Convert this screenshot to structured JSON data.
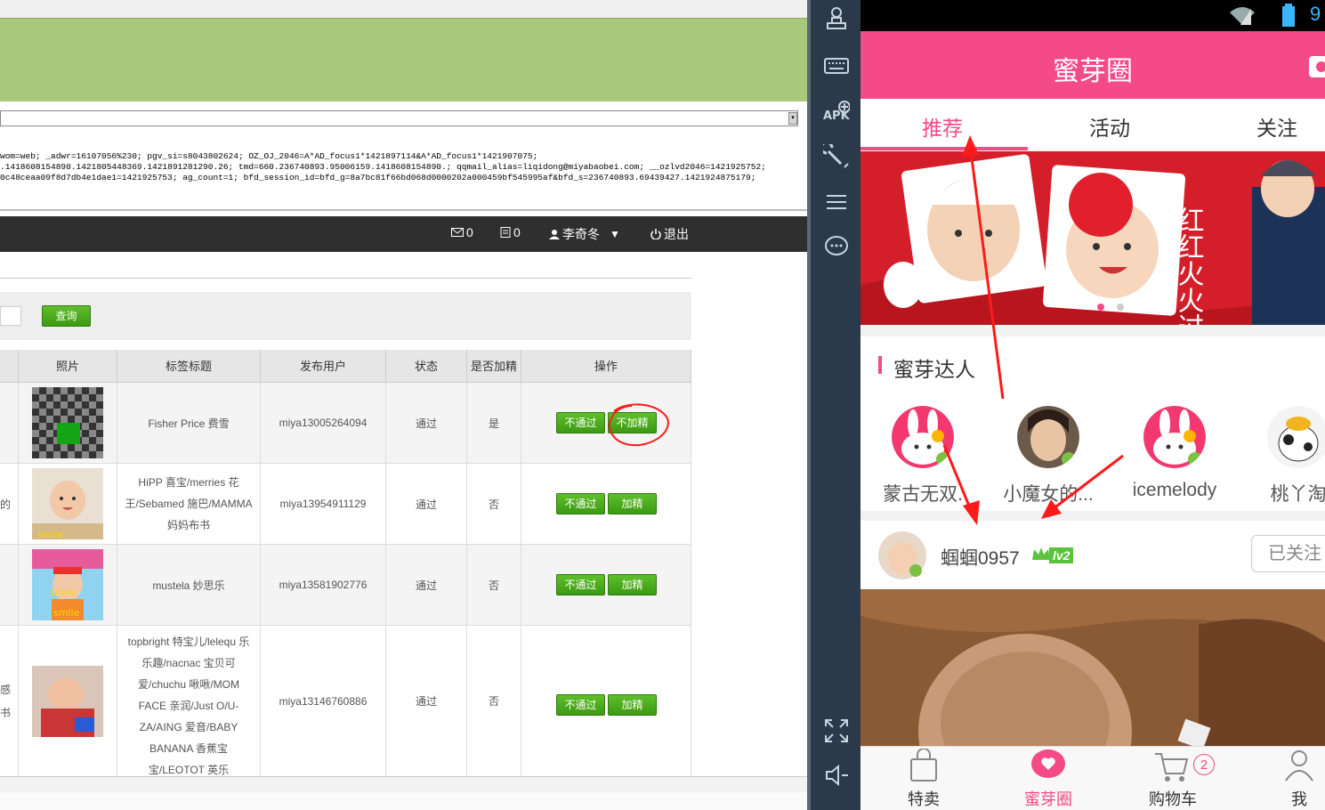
{
  "browser": {
    "cookie_lines": [
      "wom=web; _adwr=16107056%230; pgv_si=s8043802624; OZ_OJ_2046=A*AD_focus1*1421897114&A*AD_focus1*1421907075;",
      ".1418608154890.1421805448369.1421891281290.26; tmd=660.236740893.95006159.1418608154890.; qqmail_alias=liqidong@miyabaobei.com; __ozlvd2046=1421925752;",
      "0c48ceaa09f8d7db4e1dae1=1421925753; ag_count=1; bfd_session_id=bfd_g=8a7bc81f66bd068d0000202a000459bf545995af&bfd_s=236740893.69439427.1421924875179;"
    ]
  },
  "admin": {
    "nav": {
      "mail_count": "0",
      "msg_count": "0",
      "user": "李奇冬",
      "logout": "退出"
    },
    "search_button": "查询",
    "columns": [
      "照片",
      "标签标题",
      "发布用户",
      "状态",
      "是否加精",
      "操作"
    ],
    "rows": [
      {
        "left_text": "",
        "title": "Fisher Price 费雪",
        "user": "miya13005264094",
        "status": "通过",
        "featured": "是",
        "reject_label": "不通过",
        "feature_label": "不加精"
      },
      {
        "left_text": "的",
        "title": "HiPP 喜宝/merries 花王/Sebamed 施巴/MAMMA 妈妈布书",
        "user": "miya13954911129",
        "status": "通过",
        "featured": "否",
        "reject_label": "不通过",
        "feature_label": "加精"
      },
      {
        "left_text": "",
        "title": "mustela 妙思乐",
        "user": "miya13581902776",
        "status": "通过",
        "featured": "否",
        "reject_label": "不通过",
        "feature_label": "加精"
      },
      {
        "left_text": "感\n书",
        "title": "topbright 特宝儿/lelequ 乐乐趣/nacnac 宝贝可爱/chuchu 啾啾/MOM FACE 亲润/Just O/U-ZA/AING 爱音/BABY BANANA 香蕉宝宝/LEOTOT 英乐士/MUMNENA 妈咪呢喃",
        "user": "miya13146760886",
        "status": "通过",
        "featured": "否",
        "reject_label": "不通过",
        "feature_label": "加精"
      }
    ]
  },
  "phone": {
    "status_right": "9",
    "app_title": "蜜芽圈",
    "tabs": [
      "推荐",
      "活动",
      "关注"
    ],
    "banner_text": "红红火火过新年",
    "experts_title": "蜜芽达人",
    "experts": [
      "蒙古无双.",
      "小魔女的...",
      "icemelody",
      "桃丫淘"
    ],
    "post": {
      "username": "蝈蝈0957",
      "level": "lv2",
      "follow_label": "已关注"
    },
    "bottom_nav": [
      {
        "label": "特卖",
        "badge": ""
      },
      {
        "label": "蜜芽圈",
        "badge": ""
      },
      {
        "label": "购物车",
        "badge": "2"
      },
      {
        "label": "我",
        "badge": ""
      }
    ]
  },
  "colors": {
    "brand_pink": "#f44a85",
    "admin_green": "#4aab1c",
    "annotation_red": "#ff1a1a"
  }
}
